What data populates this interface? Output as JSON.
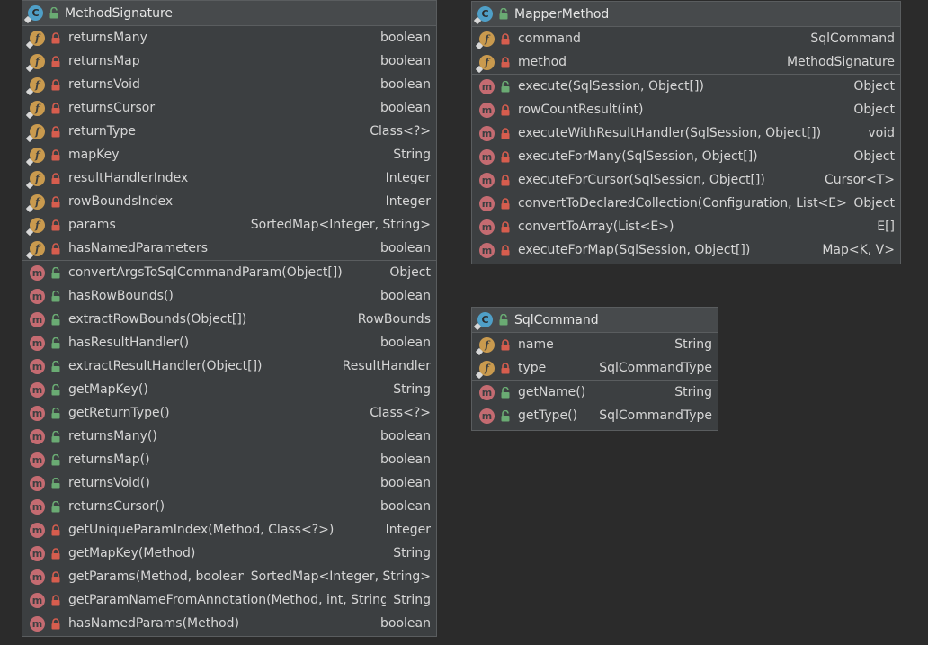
{
  "colors": {
    "background": "#2b2b2b",
    "box_background": "#3c3f41",
    "header_background": "#474a4c",
    "field_icon": "#c99a4e",
    "method_icon": "#c46b71",
    "class_icon": "#4f9fc7",
    "private_lock": "#d65d4e",
    "public_lock": "#6aab73"
  },
  "icons": {
    "class": "C",
    "field": "f",
    "method": "m"
  },
  "boxes": [
    {
      "title": "MethodSignature",
      "fields": [
        {
          "name": "returnsMany",
          "type": "boolean",
          "visibility": "private"
        },
        {
          "name": "returnsMap",
          "type": "boolean",
          "visibility": "private"
        },
        {
          "name": "returnsVoid",
          "type": "boolean",
          "visibility": "private"
        },
        {
          "name": "returnsCursor",
          "type": "boolean",
          "visibility": "private"
        },
        {
          "name": "returnType",
          "type": "Class<?>",
          "visibility": "private"
        },
        {
          "name": "mapKey",
          "type": "String",
          "visibility": "private"
        },
        {
          "name": "resultHandlerIndex",
          "type": "Integer",
          "visibility": "private"
        },
        {
          "name": "rowBoundsIndex",
          "type": "Integer",
          "visibility": "private"
        },
        {
          "name": "params",
          "type": "SortedMap<Integer, String>",
          "visibility": "private"
        },
        {
          "name": "hasNamedParameters",
          "type": "boolean",
          "visibility": "private"
        }
      ],
      "methods": [
        {
          "name": "convertArgsToSqlCommandParam(Object[])",
          "type": "Object",
          "visibility": "public"
        },
        {
          "name": "hasRowBounds()",
          "type": "boolean",
          "visibility": "public"
        },
        {
          "name": "extractRowBounds(Object[])",
          "type": "RowBounds",
          "visibility": "public"
        },
        {
          "name": "hasResultHandler()",
          "type": "boolean",
          "visibility": "public"
        },
        {
          "name": "extractResultHandler(Object[])",
          "type": "ResultHandler",
          "visibility": "public"
        },
        {
          "name": "getMapKey()",
          "type": "String",
          "visibility": "public"
        },
        {
          "name": "getReturnType()",
          "type": "Class<?>",
          "visibility": "public"
        },
        {
          "name": "returnsMany()",
          "type": "boolean",
          "visibility": "public"
        },
        {
          "name": "returnsMap()",
          "type": "boolean",
          "visibility": "public"
        },
        {
          "name": "returnsVoid()",
          "type": "boolean",
          "visibility": "public"
        },
        {
          "name": "returnsCursor()",
          "type": "boolean",
          "visibility": "public"
        },
        {
          "name": "getUniqueParamIndex(Method, Class<?>)",
          "type": "Integer",
          "visibility": "private"
        },
        {
          "name": "getMapKey(Method)",
          "type": "String",
          "visibility": "private"
        },
        {
          "name": "getParams(Method, boolean)",
          "type": "SortedMap<Integer, String>",
          "visibility": "private"
        },
        {
          "name": "getParamNameFromAnnotation(Method, int, String)",
          "type": "String",
          "visibility": "private"
        },
        {
          "name": "hasNamedParams(Method)",
          "type": "boolean",
          "visibility": "private"
        }
      ]
    },
    {
      "title": "MapperMethod",
      "fields": [
        {
          "name": "command",
          "type": "SqlCommand",
          "visibility": "private"
        },
        {
          "name": "method",
          "type": "MethodSignature",
          "visibility": "private"
        }
      ],
      "methods": [
        {
          "name": "execute(SqlSession, Object[])",
          "type": "Object",
          "visibility": "public"
        },
        {
          "name": "rowCountResult(int)",
          "type": "Object",
          "visibility": "private"
        },
        {
          "name": "executeWithResultHandler(SqlSession, Object[])",
          "type": "void",
          "visibility": "private"
        },
        {
          "name": "executeForMany(SqlSession, Object[])",
          "type": "Object",
          "visibility": "private"
        },
        {
          "name": "executeForCursor(SqlSession, Object[])",
          "type": "Cursor<T>",
          "visibility": "private"
        },
        {
          "name": "convertToDeclaredCollection(Configuration, List<E>)",
          "type": "Object",
          "visibility": "private"
        },
        {
          "name": "convertToArray(List<E>)",
          "type": "E[]",
          "visibility": "private"
        },
        {
          "name": "executeForMap(SqlSession, Object[])",
          "type": "Map<K, V>",
          "visibility": "private"
        }
      ]
    },
    {
      "title": "SqlCommand",
      "fields": [
        {
          "name": "name",
          "type": "String",
          "visibility": "private"
        },
        {
          "name": "type",
          "type": "SqlCommandType",
          "visibility": "private"
        }
      ],
      "methods": [
        {
          "name": "getName()",
          "type": "String",
          "visibility": "public"
        },
        {
          "name": "getType()",
          "type": "SqlCommandType",
          "visibility": "public"
        }
      ]
    }
  ]
}
